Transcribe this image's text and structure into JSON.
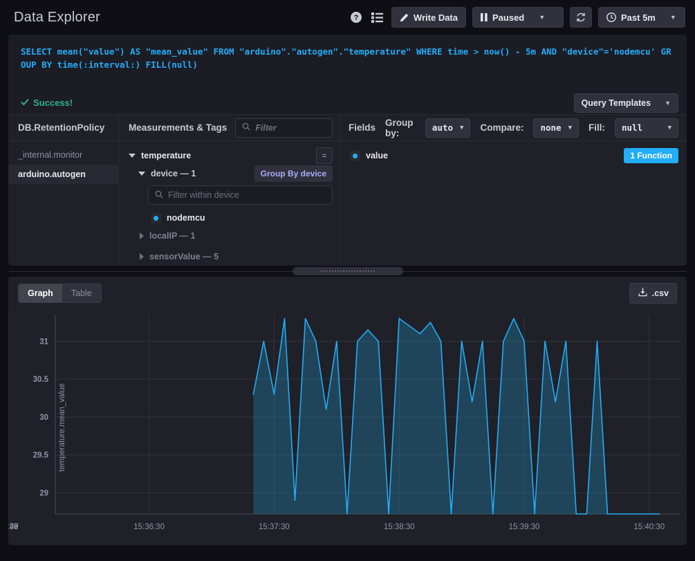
{
  "header": {
    "title": "Data Explorer",
    "help_icon": "question-circle-icon",
    "list_icon": "list-icon",
    "write_data_label": "Write Data",
    "write_data_icon": "pencil-icon",
    "paused_label": "Paused",
    "paused_icon": "pause-icon",
    "refresh_icon": "refresh-icon",
    "time_range_label": "Past 5m",
    "clock_icon": "clock-icon",
    "caret": "▼"
  },
  "query": {
    "text": "SELECT mean(\"value\") AS \"mean_value\" FROM \"arduino\".\"autogen\".\"temperature\" WHERE time > now() - 5m AND \"device\"='nodemcu' GROUP BY time(:interval:) FILL(null)",
    "status": "Success!",
    "status_icon": "check-icon",
    "templates_label": "Query Templates",
    "caret": "▼",
    "color": "#22adf6"
  },
  "schema": {
    "db_header": "DB.RetentionPolicy",
    "measurements_header": "Measurements & Tags",
    "filter_placeholder": "Filter",
    "search_icon": "search-icon",
    "databases": [
      {
        "label": "_internal.monitor",
        "active": false
      },
      {
        "label": "arduino.autogen",
        "active": true
      }
    ],
    "measurement": {
      "label": "temperature",
      "expanded": true,
      "eq_button": "="
    },
    "tags": [
      {
        "label": "device — 1",
        "expanded": true,
        "group_by_label": "Group By device",
        "inner_filter_placeholder": "Filter within device",
        "values": [
          {
            "label": "nodemcu",
            "selected": true
          }
        ]
      },
      {
        "label": "localIP — 1",
        "expanded": false
      },
      {
        "label": "sensorValue — 5",
        "expanded": false
      }
    ]
  },
  "fields": {
    "header": "Fields",
    "group_by_label": "Group by:",
    "group_by_value": "auto",
    "compare_label": "Compare:",
    "compare_value": "none",
    "fill_label": "Fill:",
    "fill_value": "null",
    "caret": "▼",
    "items": [
      {
        "label": "value",
        "selected": true,
        "function_badge": "1 Function"
      }
    ]
  },
  "graph": {
    "tabs": [
      {
        "label": "Graph",
        "active": true
      },
      {
        "label": "Table",
        "active": false
      }
    ],
    "csv_label": ".csv",
    "csv_icon": "download-icon"
  },
  "chart_data": {
    "type": "line",
    "title": "",
    "xlabel": "",
    "ylabel": "temperature.mean_value",
    "ylim": [
      28.72,
      31.35
    ],
    "yticks": [
      29,
      29.5,
      30,
      30.5,
      31
    ],
    "ytick_labels": [
      "29",
      "29.5",
      "30",
      "30.5",
      "31"
    ],
    "xlim": [
      "15:35:45",
      "15:40:45"
    ],
    "xticks": [
      "15:36",
      "15:36:30",
      "15:37",
      "15:37:30",
      "15:38",
      "15:38:30",
      "15:39",
      "15:39:30",
      "15:40",
      "15:40:30"
    ],
    "grid": true,
    "legend": false,
    "line_color": "#22adf6",
    "fill_color": "rgba(34,115,150,0.45)",
    "series": [
      {
        "name": "temperature.mean_value",
        "x": [
          "15:37:20",
          "15:37:25",
          "15:37:30",
          "15:37:35",
          "15:37:40",
          "15:37:45",
          "15:37:50",
          "15:37:55",
          "15:38:00",
          "15:38:05",
          "15:38:10",
          "15:38:15",
          "15:38:20",
          "15:38:25",
          "15:38:30",
          "15:38:35",
          "15:38:40",
          "15:38:45",
          "15:38:50",
          "15:38:55",
          "15:39:00",
          "15:39:05",
          "15:39:10",
          "15:39:15",
          "15:39:20",
          "15:39:25",
          "15:39:30",
          "15:39:35",
          "15:39:40",
          "15:39:45",
          "15:39:50",
          "15:39:55",
          "15:40:00",
          "15:40:05",
          "15:40:10",
          "15:40:15",
          "15:40:20",
          "15:40:25",
          "15:40:30",
          "15:40:35"
        ],
        "values": [
          30.3,
          31.0,
          30.3,
          31.3,
          28.9,
          31.3,
          31.0,
          30.1,
          31.0,
          28.72,
          31.0,
          31.15,
          31.0,
          28.72,
          31.3,
          31.2,
          31.1,
          31.25,
          31.0,
          28.72,
          31.0,
          30.2,
          31.0,
          28.72,
          31.0,
          31.3,
          31.0,
          28.72,
          31.0,
          30.2,
          31.0,
          28.72,
          28.72,
          31.0,
          28.72,
          28.72,
          28.72,
          28.72,
          28.72,
          28.72
        ]
      }
    ]
  }
}
